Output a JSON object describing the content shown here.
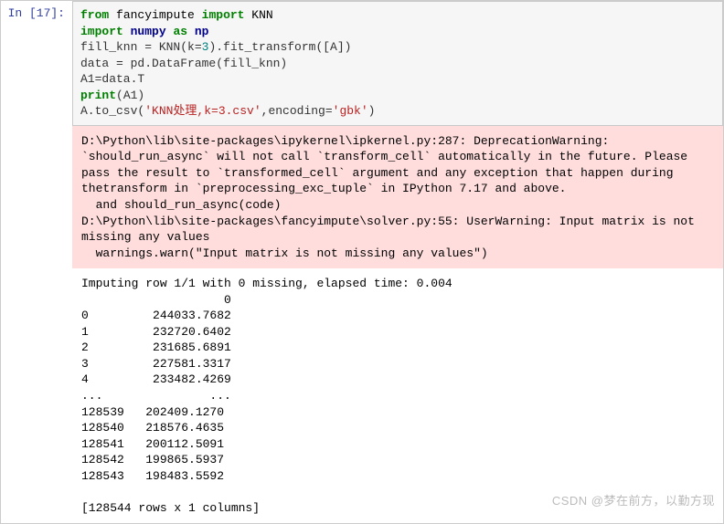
{
  "prompt": {
    "label": "In  [17]:"
  },
  "code": {
    "l1_from": "from",
    "l1_mod": "fancyimpute",
    "l1_import": "import",
    "l1_name": "KNN",
    "l2_import": "import",
    "l2_mod": "numpy",
    "l2_as": "as",
    "l2_alias": "np",
    "l3_pre": "fill_knn = KNN(k=",
    "l3_k": "3",
    "l3_post": ").fit_transform([A])",
    "l4": "data = pd.DataFrame(fill_knn)",
    "l5": "A1=data.T",
    "l6_print": "print",
    "l6_arg": "(A1)",
    "l7_pre": "A.to_csv(",
    "l7_str1": "'KNN处理,k=3.csv'",
    "l7_mid": ",encoding=",
    "l7_str2": "'gbk'",
    "l7_post": ")"
  },
  "stderr": "D:\\Python\\lib\\site-packages\\ipykernel\\ipkernel.py:287: DeprecationWarning: `should_run_async` will not call `transform_cell` automatically in the future. Please pass the result to `transformed_cell` argument and any exception that happen during thetransform in `preprocessing_exc_tuple` in IPython 7.17 and above.\n  and should_run_async(code)\nD:\\Python\\lib\\site-packages\\fancyimpute\\solver.py:55: UserWarning: Input matrix is not missing any values\n  warnings.warn(\"Input matrix is not missing any values\")",
  "stdout": "Imputing row 1/1 with 0 missing, elapsed time: 0.004\n                    0\n0         244033.7682\n1         232720.6402\n2         231685.6891\n3         227581.3317\n4         233482.4269\n...               ...\n128539   202409.1270\n128540   218576.4635\n128541   200112.5091\n128542   199865.5937\n128543   198483.5592\n\n[128544 rows x 1 columns]",
  "watermark": "CSDN @梦在前方，以勤方现"
}
